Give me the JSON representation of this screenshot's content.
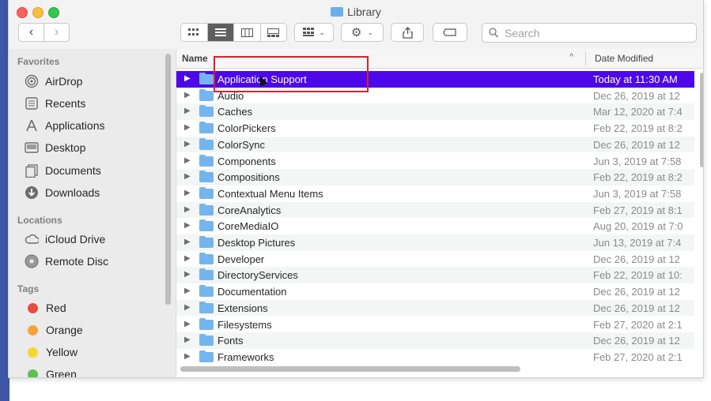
{
  "window": {
    "title": "Library"
  },
  "toolbar": {
    "back_icon": "chevron-left-icon",
    "forward_icon": "chevron-right-icon",
    "views": [
      "icon-view",
      "list-view",
      "column-view",
      "gallery-view"
    ],
    "active_view": "list-view",
    "search_placeholder": "Search"
  },
  "sidebar": {
    "favorites_heading": "Favorites",
    "favorites": [
      {
        "label": "AirDrop",
        "icon": "airdrop-icon"
      },
      {
        "label": "Recents",
        "icon": "recents-icon"
      },
      {
        "label": "Applications",
        "icon": "applications-icon"
      },
      {
        "label": "Desktop",
        "icon": "desktop-icon"
      },
      {
        "label": "Documents",
        "icon": "documents-icon"
      },
      {
        "label": "Downloads",
        "icon": "downloads-icon"
      }
    ],
    "locations_heading": "Locations",
    "locations": [
      {
        "label": "iCloud Drive",
        "icon": "cloud-icon"
      },
      {
        "label": "Remote Disc",
        "icon": "disc-icon"
      }
    ],
    "tags_heading": "Tags",
    "tags": [
      {
        "label": "Red",
        "color": "#e94a3f"
      },
      {
        "label": "Orange",
        "color": "#f5a33d"
      },
      {
        "label": "Yellow",
        "color": "#f6d631"
      },
      {
        "label": "Green",
        "color": "#5ac24f"
      }
    ]
  },
  "list": {
    "columns": {
      "name": "Name",
      "date": "Date Modified"
    },
    "selected_color": "#4d08ea",
    "rows": [
      {
        "name": "Application Support",
        "date": "Today at 11:30 AM"
      },
      {
        "name": "Audio",
        "date": "Dec 26, 2019 at 12"
      },
      {
        "name": "Caches",
        "date": "Mar 12, 2020 at 7:4"
      },
      {
        "name": "ColorPickers",
        "date": "Feb 22, 2019 at 8:2"
      },
      {
        "name": "ColorSync",
        "date": "Dec 26, 2019 at 12"
      },
      {
        "name": "Components",
        "date": "Jun 3, 2019 at 7:58"
      },
      {
        "name": "Compositions",
        "date": "Feb 22, 2019 at 8:2"
      },
      {
        "name": "Contextual Menu Items",
        "date": "Jun 3, 2019 at 7:58"
      },
      {
        "name": "CoreAnalytics",
        "date": "Feb 27, 2019 at 8:1"
      },
      {
        "name": "CoreMediaIO",
        "date": "Aug 20, 2019 at 7:0"
      },
      {
        "name": "Desktop Pictures",
        "date": "Jun 13, 2019 at 7:4"
      },
      {
        "name": "Developer",
        "date": "Dec 26, 2019 at 12"
      },
      {
        "name": "DirectoryServices",
        "date": "Feb 22, 2019 at 10:"
      },
      {
        "name": "Documentation",
        "date": "Dec 26, 2019 at 12"
      },
      {
        "name": "Extensions",
        "date": "Dec 26, 2019 at 12"
      },
      {
        "name": "Filesystems",
        "date": "Feb 27, 2020 at 2:1"
      },
      {
        "name": "Fonts",
        "date": "Dec 26, 2019 at 12"
      },
      {
        "name": "Frameworks",
        "date": "Feb 27, 2020 at 2:1"
      }
    ]
  }
}
